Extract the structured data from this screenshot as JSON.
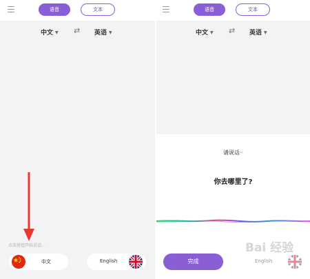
{
  "left": {
    "tabs": {
      "voice": "语音",
      "text": "文本"
    },
    "languages": {
      "source": "中文",
      "target": "英语"
    },
    "hint": "点击按钮开始说话...",
    "source_pill_label": "中文",
    "target_pill_label": "English"
  },
  "right": {
    "tabs": {
      "voice": "语音",
      "text": "文本"
    },
    "languages": {
      "source": "中文",
      "target": "英语"
    },
    "listening_prompt": "请说话··",
    "recognized_text": "你去哪里了?",
    "done_button": "完成",
    "target_pill_label": "English"
  },
  "watermark": "Bai 经验",
  "colors": {
    "accent": "#8a5fd6",
    "arrow": "#e53935"
  }
}
